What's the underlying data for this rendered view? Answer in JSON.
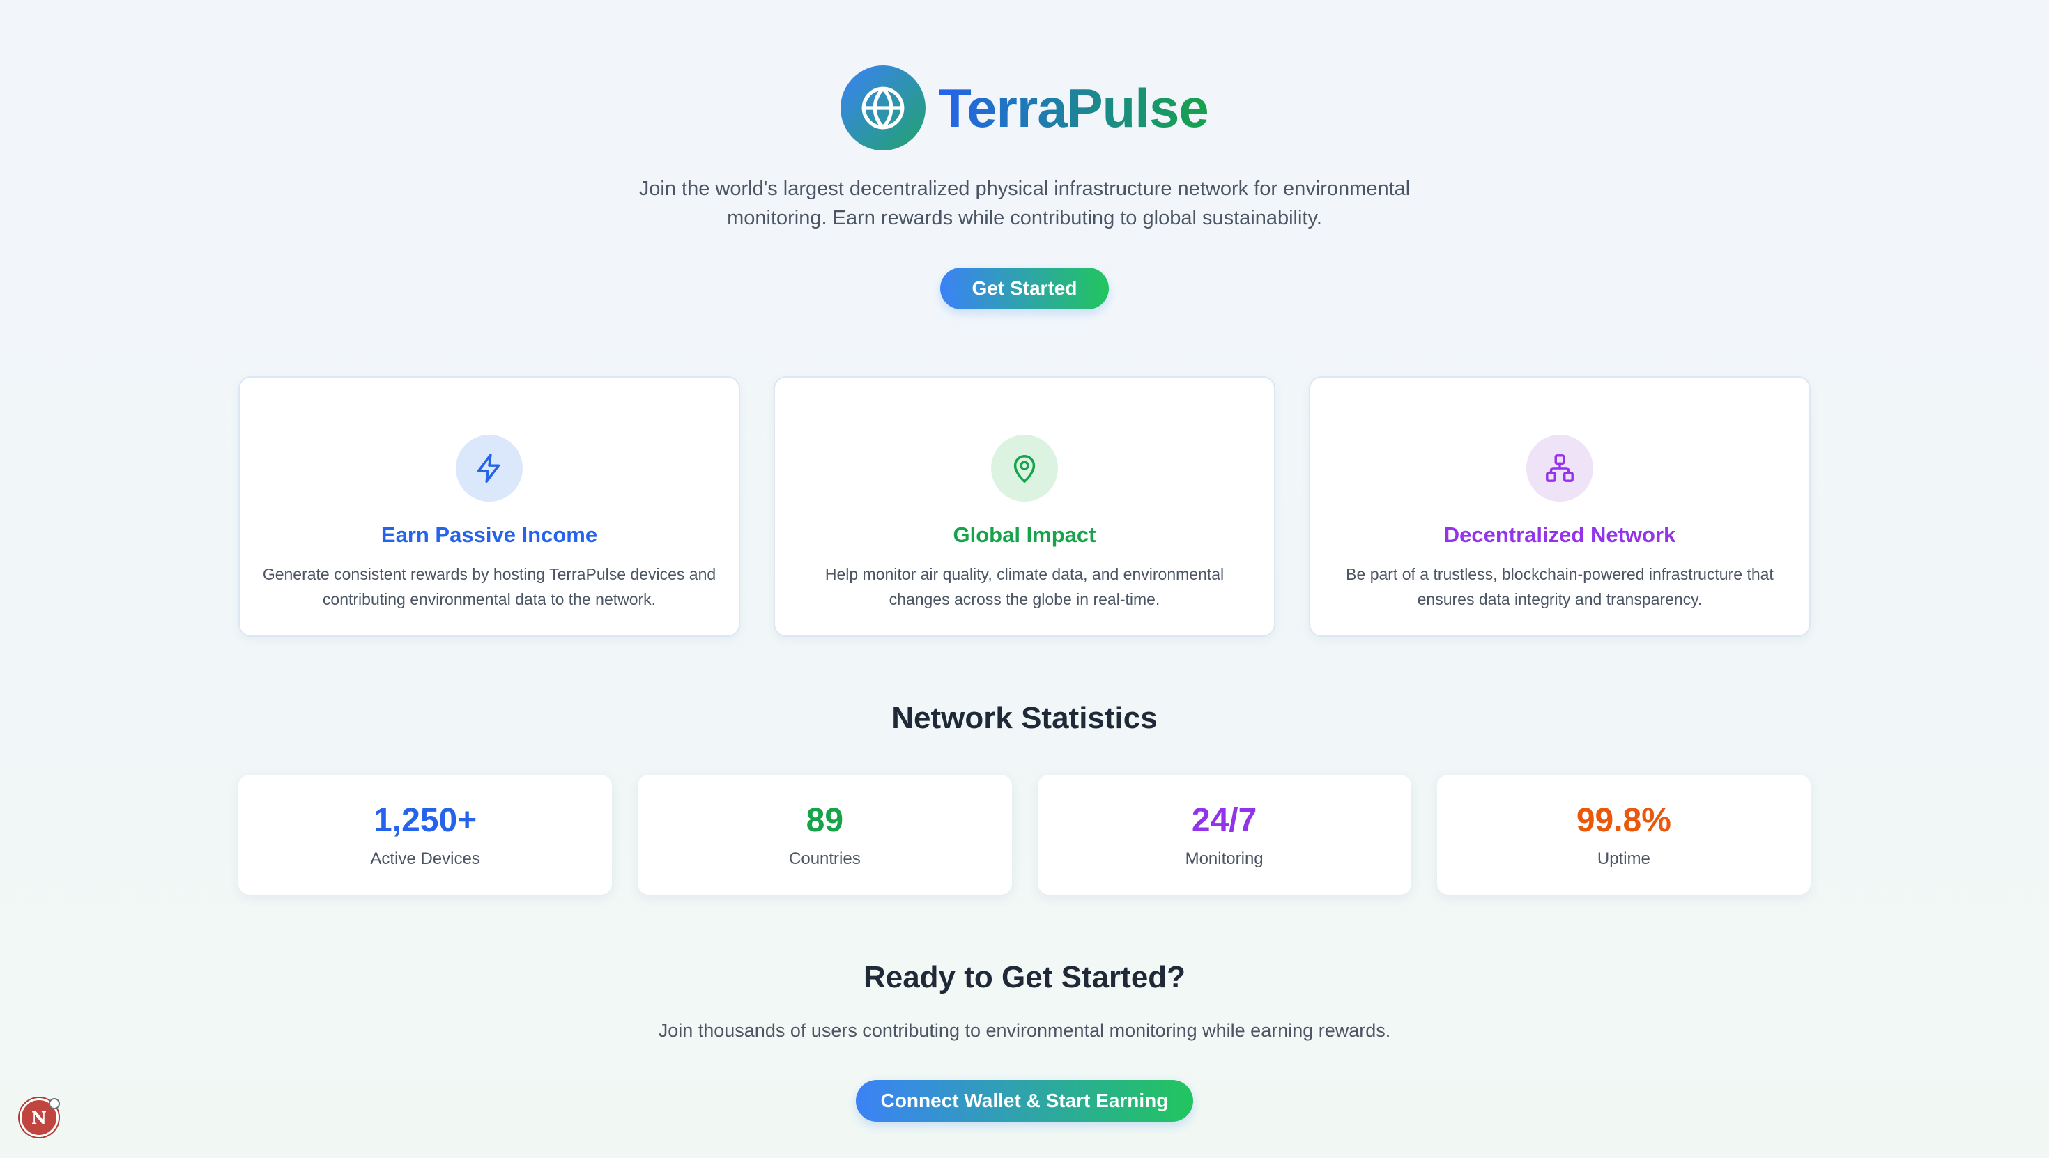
{
  "brand": {
    "name": "TerraPulse",
    "logo_icon": "globe-icon",
    "gradient": [
      "#3b82f6",
      "#16a34a"
    ]
  },
  "hero": {
    "tagline": "Join the world's largest decentralized physical infrastructure network for environmental monitoring. Earn rewards while contributing to global sustainability.",
    "cta_label": "Get Started"
  },
  "features": [
    {
      "title": "Earn Passive Income",
      "description": "Generate consistent rewards by hosting TerraPulse devices and contributing environmental data to the network.",
      "icon": "lightning-icon",
      "color": "#2563eb",
      "icon_bg": "#dbe7fb"
    },
    {
      "title": "Global Impact",
      "description": "Help monitor air quality, climate data, and environmental changes across the globe in real-time.",
      "icon": "map-pin-icon",
      "color": "#16a34a",
      "icon_bg": "#dcf3e2"
    },
    {
      "title": "Decentralized Network",
      "description": "Be part of a trustless, blockchain-powered infrastructure that ensures data integrity and transparency.",
      "icon": "network-icon",
      "color": "#9333ea",
      "icon_bg": "#efe3f8"
    }
  ],
  "stats": {
    "title": "Network Statistics",
    "items": [
      {
        "value": "1,250+",
        "label": "Active Devices",
        "color": "#2563eb"
      },
      {
        "value": "89",
        "label": "Countries",
        "color": "#16a34a"
      },
      {
        "value": "24/7",
        "label": "Monitoring",
        "color": "#9333ea"
      },
      {
        "value": "99.8%",
        "label": "Uptime",
        "color": "#ea580c"
      }
    ]
  },
  "cta": {
    "title": "Ready to Get Started?",
    "description": "Join thousands of users contributing to environmental monitoring while earning rewards.",
    "button_label": "Connect Wallet & Start Earning"
  },
  "corner_badge": {
    "letter": "N",
    "color": "#c0453f"
  }
}
